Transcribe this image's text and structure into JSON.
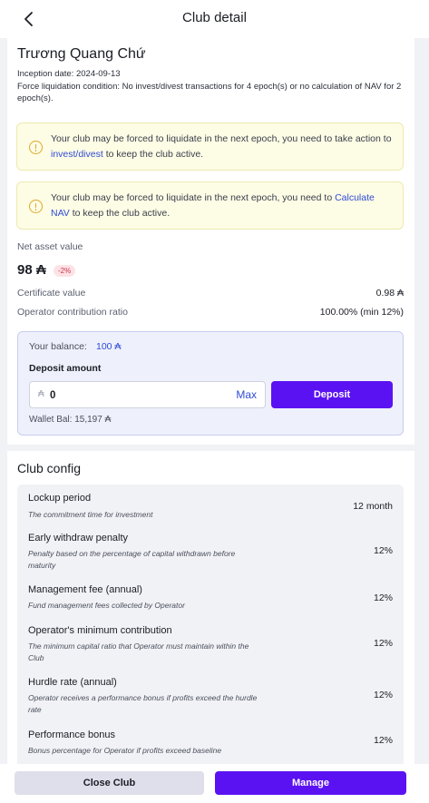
{
  "header": {
    "title": "Club detail",
    "back_icon": "chevron-left-icon"
  },
  "club": {
    "name": "Trương Quang Chứ",
    "inception": "Inception date: 2024-09-13",
    "force_condition": "Force liquidation condition: No invest/divest transactions for 4 epoch(s) or no calculation of NAV for 2 epoch(s)."
  },
  "alerts": [
    {
      "text_before": "Your club may be forced to liquidate in the next epoch, you need to take action to ",
      "link": "invest/divest",
      "text_after": " to keep the club active."
    },
    {
      "text_before": "Your club may be forced to liquidate in the next epoch, you need to ",
      "link": "Calculate NAV",
      "text_after": " to keep the club active."
    }
  ],
  "nav": {
    "label": "Net asset value",
    "value": "98 ₳",
    "change": "-2%",
    "certificate_label": "Certificate value",
    "certificate_value": "0.98 ₳",
    "ratio_label": "Operator contribution ratio",
    "ratio_value": "100.00% (min 12%)"
  },
  "deposit": {
    "balance_label": "Your balance:",
    "balance_value": "100 ₳",
    "amount_label": "Deposit amount",
    "currency_symbol": "₳",
    "amount_value": "0",
    "max_label": "Max",
    "button_label": "Deposit",
    "wallet_balance": "Wallet Bal: 15,197 ₳"
  },
  "config": {
    "title": "Club config",
    "items": [
      {
        "title": "Lockup period",
        "desc": "The commitment time for investment",
        "value": "12 month"
      },
      {
        "title": "Early withdraw penalty",
        "desc": "Penalty based on the percentage of capital withdrawn before maturity",
        "value": "12%"
      },
      {
        "title": "Management fee (annual)",
        "desc": "Fund management fees collected by Operator",
        "value": "12%"
      },
      {
        "title": "Operator's minimum contribution",
        "desc": "The minimum capital ratio that Operator must maintain within the Club",
        "value": "12%"
      },
      {
        "title": "Hurdle rate (annual)",
        "desc": "Operator receives a performance bonus if profits exceed the hurdle rate",
        "value": "12%"
      },
      {
        "title": "Performance bonus",
        "desc": "Bonus percentage for Operator if profits exceed baseline",
        "value": "12%"
      }
    ]
  },
  "footer": {
    "close_label": "Close Club",
    "manage_label": "Manage"
  },
  "colors": {
    "primary": "#5b12f2",
    "link": "#2f4bd6",
    "alert_bg": "#fdfce5",
    "warning": "#e0a92a",
    "negative": "#d3314a"
  }
}
